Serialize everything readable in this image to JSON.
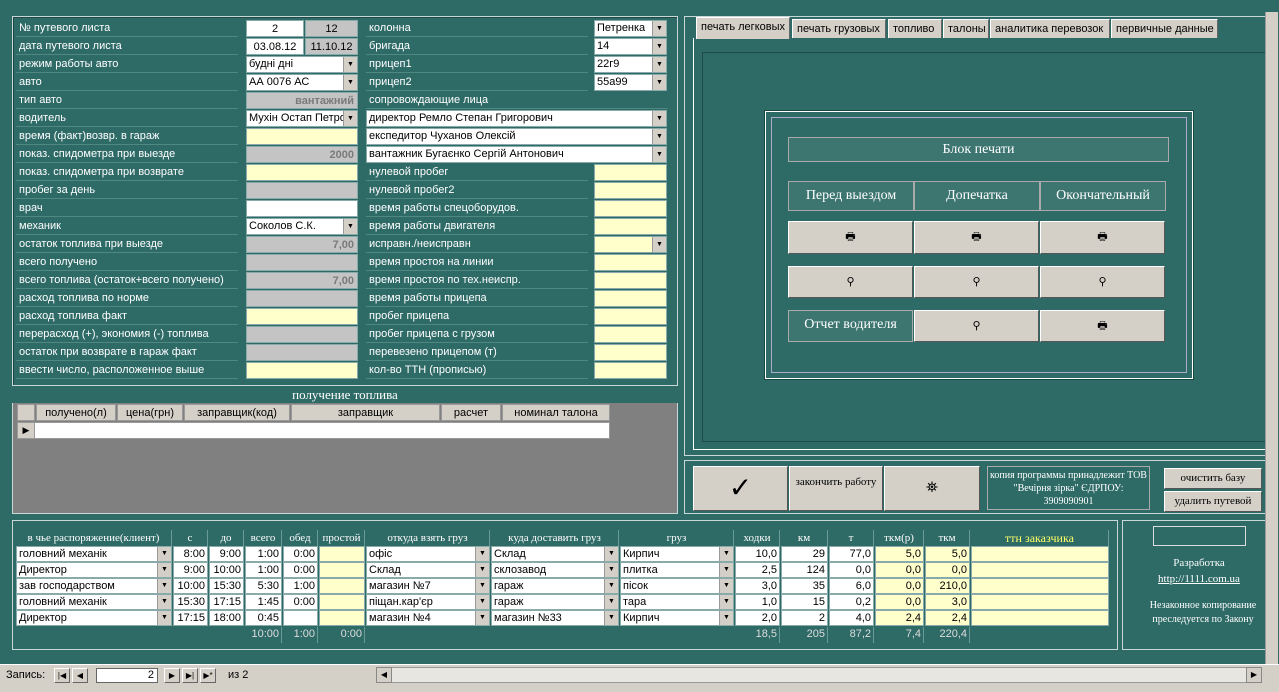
{
  "left_fields": {
    "labels": [
      "№ путевого листа",
      "дата путевого листа",
      "режим работы авто",
      "авто",
      "тип авто",
      "водитель",
      "время (факт)возвр. в гараж",
      "показ. спидометра при выезде",
      "показ. спидометра при возврате",
      "пробег за день",
      "врач",
      "механик",
      "остаток топлива при выезде",
      "всего получено",
      "всего топлива (остаток+всего получено)",
      "расход топлива по норме",
      "расход топлива факт",
      "перерасход (+), экономия (-) топлива",
      "остаток при возврате в гараж  факт",
      "ввести число, расположенное выше"
    ],
    "waybill_no": "2",
    "waybill_no2": "12",
    "date": "03.08.12",
    "date2": "11.10.12",
    "mode": "будні дні",
    "auto": "АА 0076 АС",
    "auto_type": "вантажний",
    "driver": "Мухін Остап Петро",
    "speedo_out": "2000",
    "mechanic": "Соколов С.К.",
    "fuel_out": "7,00",
    "fuel_total": "7,00"
  },
  "mid_fields": {
    "labels": [
      "колонна",
      "бригада",
      "прицеп1",
      "прицеп2"
    ],
    "values": [
      "Петренка",
      "14",
      "22г9",
      "55а99"
    ],
    "escort_label": "сопровождающие лица",
    "escorts": [
      "директор Ремло Степан Григорович",
      "експедитор Чуханов Олексій",
      "вантажник Бугаєнко Сергій Антонович"
    ],
    "labels2": [
      "нулевой пробег",
      "нулевой пробег2",
      "время работы спецоборудов.",
      "время работы двигателя",
      "исправн./неисправн",
      "время простоя на линии",
      "время простоя по тех.неиспр.",
      "время работы прицепа",
      "пробег прицепа",
      "пробег прицепа с грузом",
      "перевезено прицепом (т)",
      "кол-во ТТН (прописью)"
    ]
  },
  "fuel": {
    "title": "получение топлива",
    "cols": [
      "получено(л)",
      "цена(грн)",
      "заправщик(код)",
      "заправщик",
      "расчет",
      "номинал талона"
    ]
  },
  "tabs": [
    "печать легковых",
    "печать грузовых",
    "топливо",
    "талоны",
    "аналитика перевозок",
    "первичные данные"
  ],
  "print_block": {
    "title": "Блок печати",
    "cols": [
      "Перед выездом",
      "Допечатка",
      "Окончательный"
    ],
    "driver_report": "Отчет водителя"
  },
  "actions": {
    "finish": "закончить работу",
    "copyright": "копия программы  принадлежит ТОВ \"Вечірня зірка\" ЄДРПОУ: 3909090901",
    "clear": "очистить базу",
    "delete": "удалить путевой"
  },
  "grid": {
    "headers": [
      "в чье распоряжение(клиент)",
      "с",
      "до",
      "всего",
      "обед",
      "простой",
      "откуда взять груз",
      "куда доставить груз",
      "груз",
      "ходки",
      "км",
      "т",
      "ткм(р)",
      "ткм",
      "ттн заказчика"
    ],
    "rows": [
      [
        "головний механік",
        "8:00",
        "9:00",
        "1:00",
        "0:00",
        "",
        "офіс",
        "Склад",
        "Кирпич",
        "10,0",
        "29",
        "77,0",
        "5,0",
        "5,0"
      ],
      [
        "Директор",
        "9:00",
        "10:00",
        "1:00",
        "0:00",
        "",
        "Склад",
        "склозавод",
        "плитка",
        "2,5",
        "124",
        "0,0",
        "0,0",
        "0,0"
      ],
      [
        "зав господарством",
        "10:00",
        "15:30",
        "5:30",
        "1:00",
        "",
        "магазин №7",
        "гараж",
        "пісок",
        "3,0",
        "35",
        "6,0",
        "0,0",
        "210,0"
      ],
      [
        "головний механік",
        "15:30",
        "17:15",
        "1:45",
        "0:00",
        "",
        "піщан.кар'єр",
        "гараж",
        "тара",
        "1,0",
        "15",
        "0,2",
        "0,0",
        "3,0"
      ],
      [
        "Директор",
        "17:15",
        "18:00",
        "0:45",
        "",
        "",
        "магазин №4",
        "магазин №33",
        "Кирпич",
        "2,0",
        "2",
        "4,0",
        "2,4",
        "2,4"
      ]
    ],
    "totals": {
      "vsego": "10:00",
      "obed": "1:00",
      "prostoy": "0:00",
      "hodki": "18,5",
      "km": "205",
      "t": "87,2",
      "tkmr": "7,4",
      "tkm": "220,4"
    }
  },
  "dev": {
    "label": "Разработка",
    "url": "http://1111.com.ua",
    "warn": "Незаконное копирование преследуется по Закону"
  },
  "nav": {
    "label": "Запись:",
    "current": "2",
    "of": "из  2"
  }
}
